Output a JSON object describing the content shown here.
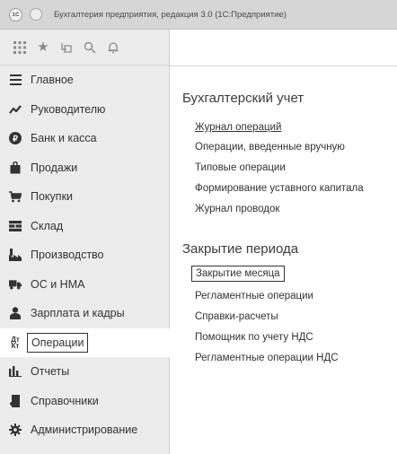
{
  "window": {
    "logo_text": "1С",
    "title": "Бухгалтерия предприятия, редакция 3.0  (1С:Предприятие)"
  },
  "toolbar": {
    "icons": [
      "apps-grid-icon",
      "star-icon",
      "history-icon",
      "search-icon",
      "bell-icon"
    ]
  },
  "sidebar": {
    "items": [
      {
        "label": "Главное",
        "icon": "hamburger-icon"
      },
      {
        "label": "Руководителю",
        "icon": "trend-icon"
      },
      {
        "label": "Банк и касса",
        "icon": "bank-icon"
      },
      {
        "label": "Продажи",
        "icon": "shopping-bag-icon"
      },
      {
        "label": "Покупки",
        "icon": "cart-icon"
      },
      {
        "label": "Склад",
        "icon": "warehouse-icon"
      },
      {
        "label": "Производство",
        "icon": "factory-icon"
      },
      {
        "label": "ОС и НМА",
        "icon": "truck-icon"
      },
      {
        "label": "Зарплата и кадры",
        "icon": "person-icon"
      },
      {
        "label": "Операции",
        "icon": "operations-icon",
        "active": true
      },
      {
        "label": "Отчеты",
        "icon": "bar-chart-icon"
      },
      {
        "label": "Справочники",
        "icon": "book-icon"
      },
      {
        "label": "Администрирование",
        "icon": "gear-icon"
      }
    ]
  },
  "content": {
    "sections": [
      {
        "title": "Бухгалтерский учет",
        "links": [
          {
            "label": "Журнал операций"
          },
          {
            "label": "Операции, введенные вручную"
          },
          {
            "label": "Типовые операции"
          },
          {
            "label": "Формирование уставного капитала"
          },
          {
            "label": "Журнал проводок"
          }
        ]
      },
      {
        "title": "Закрытие периода",
        "links": [
          {
            "label": "Закрытие месяца"
          },
          {
            "label": "Регламентные операции"
          },
          {
            "label": "Справки-расчеты"
          },
          {
            "label": "Помощник по учету НДС"
          },
          {
            "label": "Регламентные операции НДС"
          }
        ]
      }
    ]
  }
}
